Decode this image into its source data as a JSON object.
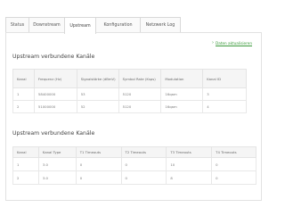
{
  "tabs": [
    {
      "label": "Status",
      "active": false
    },
    {
      "label": "Downstream",
      "active": false
    },
    {
      "label": "Upstream",
      "active": true
    },
    {
      "label": "Konfiguration",
      "active": false
    },
    {
      "label": "Netzwerk Log",
      "active": false
    }
  ],
  "refresh_link": "Daten aktualisieren",
  "section1": {
    "title": "Upstream verbundene Kanäle",
    "columns": [
      "Kanal",
      "Frequenz (Hz)",
      "Signalstärke (dBmV)",
      "Symbol Rate (Ksps)",
      "Modulation",
      "Kanal ID"
    ],
    "rows": [
      [
        "1",
        "58400000",
        "53",
        "5120",
        "16qam",
        "3"
      ],
      [
        "2",
        "51000000",
        "52",
        "5120",
        "16qam",
        "4"
      ]
    ]
  },
  "section2": {
    "title": "Upstream verbundene Kanäle",
    "columns": [
      "Kanal",
      "Kanal Type",
      "T1 Timeouts",
      "T2 Timeouts",
      "T3 Timeouts",
      "T4 Timeouts"
    ],
    "rows": [
      [
        "1",
        "3.0",
        "0",
        "0",
        "10",
        "0"
      ],
      [
        "2",
        "3.0",
        "0",
        "0",
        "8",
        "0"
      ]
    ]
  },
  "colors": {
    "accent": "#3a9a3a",
    "border": "#e2e2e2",
    "header_bg": "#f5f5f5"
  }
}
